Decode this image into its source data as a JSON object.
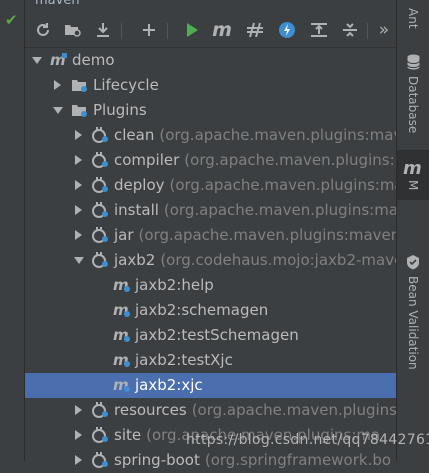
{
  "window": {
    "title": "maven"
  },
  "toolbar": {
    "buttons": [
      {
        "icon": "reload-icon"
      },
      {
        "icon": "generate-sources-icon"
      },
      {
        "icon": "download-icon"
      },
      {
        "icon": "add-icon"
      },
      {
        "icon": "run-icon"
      },
      {
        "icon": "maven-goal-icon",
        "glyph": "m"
      },
      {
        "icon": "toggle-offline-icon"
      },
      {
        "icon": "skip-tests-icon"
      },
      {
        "icon": "show-dependencies-icon"
      },
      {
        "icon": "collapse-all-icon"
      },
      {
        "icon": "more-icon",
        "glyph": "»"
      }
    ]
  },
  "tree": [
    {
      "label": "demo",
      "pkg": "",
      "icon": "maven-project-icon",
      "expanded": true
    },
    {
      "label": "Lifecycle",
      "pkg": "",
      "icon": "folder-gear-icon",
      "expanded": false
    },
    {
      "label": "Plugins",
      "pkg": "",
      "icon": "folder-gear-icon",
      "expanded": true
    },
    {
      "label": "clean",
      "pkg": "(org.apache.maven.plugins:mave",
      "icon": "plugin-icon",
      "expanded": false
    },
    {
      "label": "compiler",
      "pkg": "(org.apache.maven.plugins:m",
      "icon": "plugin-icon",
      "expanded": false
    },
    {
      "label": "deploy",
      "pkg": "(org.apache.maven.plugins:ma",
      "icon": "plugin-icon",
      "expanded": false
    },
    {
      "label": "install",
      "pkg": "(org.apache.maven.plugins:maven-i",
      "icon": "plugin-icon",
      "expanded": false
    },
    {
      "label": "jar",
      "pkg": "(org.apache.maven.plugins:maven-j",
      "icon": "plugin-icon",
      "expanded": false
    },
    {
      "label": "jaxb2",
      "pkg": "(org.codehaus.mojo:jaxb2-mave",
      "icon": "plugin-icon",
      "expanded": true
    },
    {
      "label": "jaxb2:help",
      "pkg": "",
      "icon": "goal-icon"
    },
    {
      "label": "jaxb2:schemagen",
      "pkg": "",
      "icon": "goal-icon"
    },
    {
      "label": "jaxb2:testSchemagen",
      "pkg": "",
      "icon": "goal-icon"
    },
    {
      "label": "jaxb2:testXjc",
      "pkg": "",
      "icon": "goal-icon"
    },
    {
      "label": "jaxb2:xjc",
      "pkg": "",
      "icon": "goal-icon",
      "selected": true
    },
    {
      "label": "resources",
      "pkg": "(org.apache.maven.plugins:m",
      "icon": "plugin-icon",
      "expanded": false
    },
    {
      "label": "site",
      "pkg": "(org.apache.maven.plugins:ma",
      "icon": "plugin-icon",
      "expanded": false
    },
    {
      "label": "spring-boot",
      "pkg": "(org.springframework.bo",
      "icon": "plugin-icon",
      "expanded": false
    }
  ],
  "right_tabs": [
    {
      "label": "Ant",
      "icon": "ant-icon"
    },
    {
      "label": "Database",
      "icon": "database-icon"
    },
    {
      "label": "M",
      "icon": "maven-icon",
      "active": true
    },
    {
      "label": "Bean Validation",
      "icon": "bean-validation-icon"
    }
  ],
  "watermark": "https://blog.csdn.net/qq78442761",
  "colors": {
    "background": "#3c3f41",
    "selection": "#4b6eaf",
    "text": "#bbbbbb",
    "muted": "#808080",
    "run": "#4caf50",
    "accent": "#3d8fd1"
  }
}
